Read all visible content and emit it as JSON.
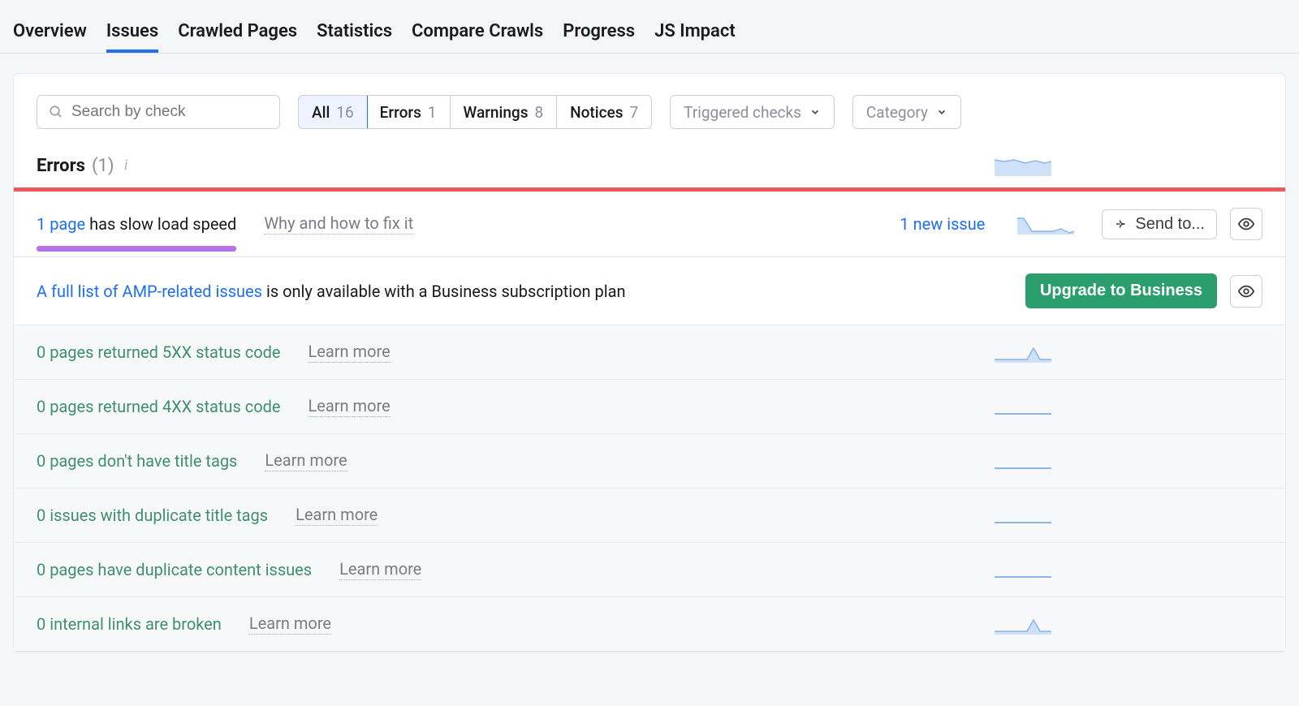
{
  "nav": {
    "tabs": [
      {
        "label": "Overview"
      },
      {
        "label": "Issues"
      },
      {
        "label": "Crawled Pages"
      },
      {
        "label": "Statistics"
      },
      {
        "label": "Compare Crawls"
      },
      {
        "label": "Progress"
      },
      {
        "label": "JS Impact"
      }
    ],
    "active_index": 1
  },
  "search": {
    "placeholder": "Search by check"
  },
  "filters": [
    {
      "label": "All",
      "count": "16"
    },
    {
      "label": "Errors",
      "count": "1"
    },
    {
      "label": "Warnings",
      "count": "8"
    },
    {
      "label": "Notices",
      "count": "7"
    }
  ],
  "dropdowns": {
    "triggered": "Triggered checks",
    "category": "Category"
  },
  "section": {
    "title": "Errors",
    "count": "(1)"
  },
  "row_active": {
    "count": "1 page",
    "rest": " has slow load speed",
    "fix": "Why and how to fix it",
    "new_issue": "1 new issue",
    "send_to": "Send to..."
  },
  "row_amp": {
    "link": "A full list of AMP-related issues",
    "rest": " is only available with a Business subscription plan",
    "upgrade": "Upgrade to Business"
  },
  "learn_more": "Learn more",
  "zero_rows": [
    {
      "text": "0 pages returned 5XX status code",
      "spark": "peak"
    },
    {
      "text": "0 pages returned 4XX status code",
      "spark": "flat"
    },
    {
      "text": "0 pages don't have title tags",
      "spark": "flat"
    },
    {
      "text": "0 issues with duplicate title tags",
      "spark": "flat"
    },
    {
      "text": "0 pages have duplicate content issues",
      "spark": "flat"
    },
    {
      "text": "0 internal links are broken",
      "spark": "peak"
    }
  ]
}
